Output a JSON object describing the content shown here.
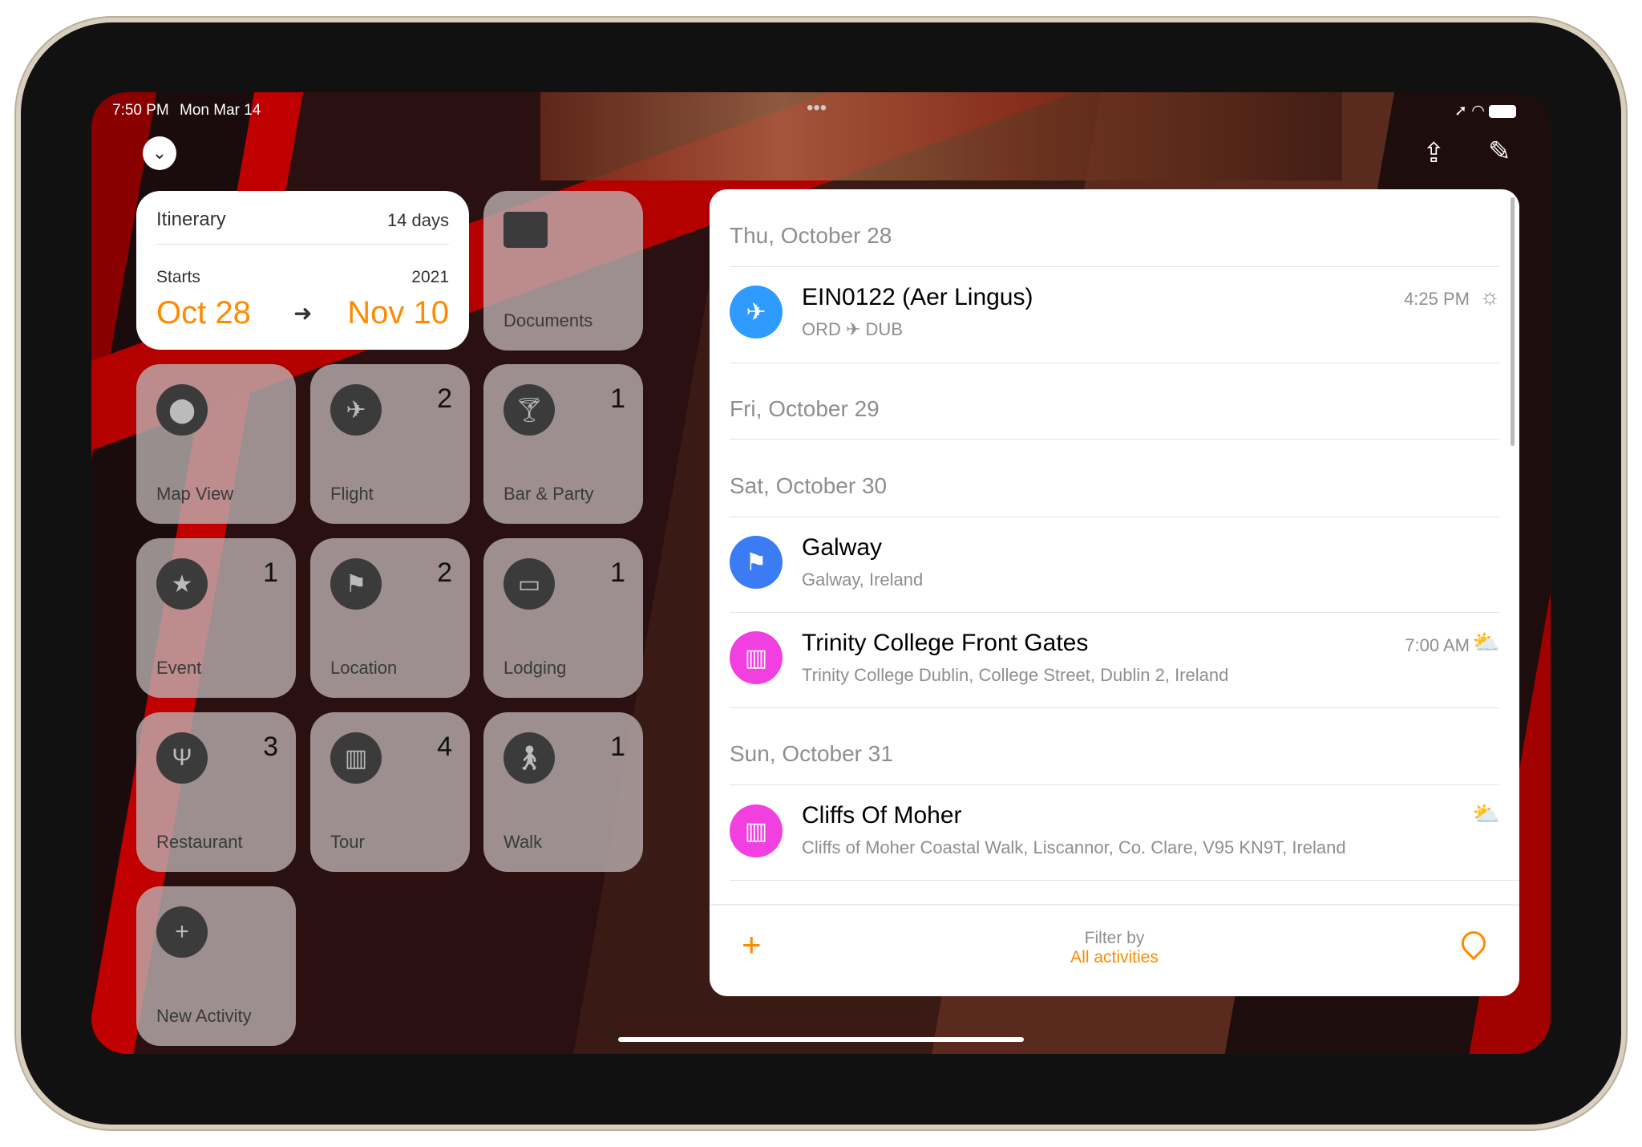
{
  "status_bar": {
    "time": "7:50 PM",
    "date": "Mon Mar 14",
    "dots": "•••"
  },
  "toolbar": {
    "collapse_icon": "chevron-down-icon",
    "share_icon": "share-icon",
    "edit_icon": "pencil-icon"
  },
  "itinerary": {
    "title": "Itinerary",
    "duration": "14 days",
    "starts_label": "Starts",
    "year": "2021",
    "start_date": "Oct 28",
    "end_date": "Nov 10",
    "accent": "#ff8a00"
  },
  "documents": {
    "label": "Documents",
    "icon": "folder-icon"
  },
  "tiles": [
    {
      "label": "Map View",
      "count": "",
      "icon": "map-pin-icon"
    },
    {
      "label": "Flight",
      "count": "2",
      "icon": "airplane-icon"
    },
    {
      "label": "Bar & Party",
      "count": "1",
      "icon": "cocktail-icon"
    },
    {
      "label": "Event",
      "count": "1",
      "icon": "ticket-icon"
    },
    {
      "label": "Location",
      "count": "2",
      "icon": "flag-icon"
    },
    {
      "label": "Lodging",
      "count": "1",
      "icon": "bed-icon"
    },
    {
      "label": "Restaurant",
      "count": "3",
      "icon": "fork-knife-icon"
    },
    {
      "label": "Tour",
      "count": "4",
      "icon": "map-icon"
    },
    {
      "label": "Walk",
      "count": "1",
      "icon": "walk-icon"
    },
    {
      "label": "New Activity",
      "count": "",
      "icon": "plus-icon"
    }
  ],
  "timeline": {
    "days": [
      "Thu, October 28",
      "Fri, October 29",
      "Sat, October 30",
      "Sun, October 31"
    ],
    "events": [
      {
        "title": "EIN0122 (Aer Lingus)",
        "subtitle": "ORD ✈ DUB",
        "time": "4:25 PM",
        "weather": "sun-icon",
        "color": "#2f9bff"
      },
      {
        "title": "Galway",
        "subtitle": "Galway, Ireland",
        "time": "",
        "weather": "",
        "color": "#3b7cf5"
      },
      {
        "title": "Trinity College Front Gates",
        "subtitle": "Trinity College Dublin, College Street, Dublin 2, Ireland",
        "time": "7:00 AM",
        "weather": "sunrise-icon",
        "color": "#f23fe0"
      },
      {
        "title": "Cliffs Of Moher",
        "subtitle": "Cliffs of Moher Coastal Walk, Liscannor, Co. Clare, V95 KN9T, Ireland",
        "time": "",
        "weather": "sunrise-icon",
        "color": "#f23fe0"
      }
    ]
  },
  "footer": {
    "filter_label": "Filter by",
    "filter_value": "All activities",
    "add_icon": "plus-icon",
    "map_icon": "map-pin-icon"
  }
}
